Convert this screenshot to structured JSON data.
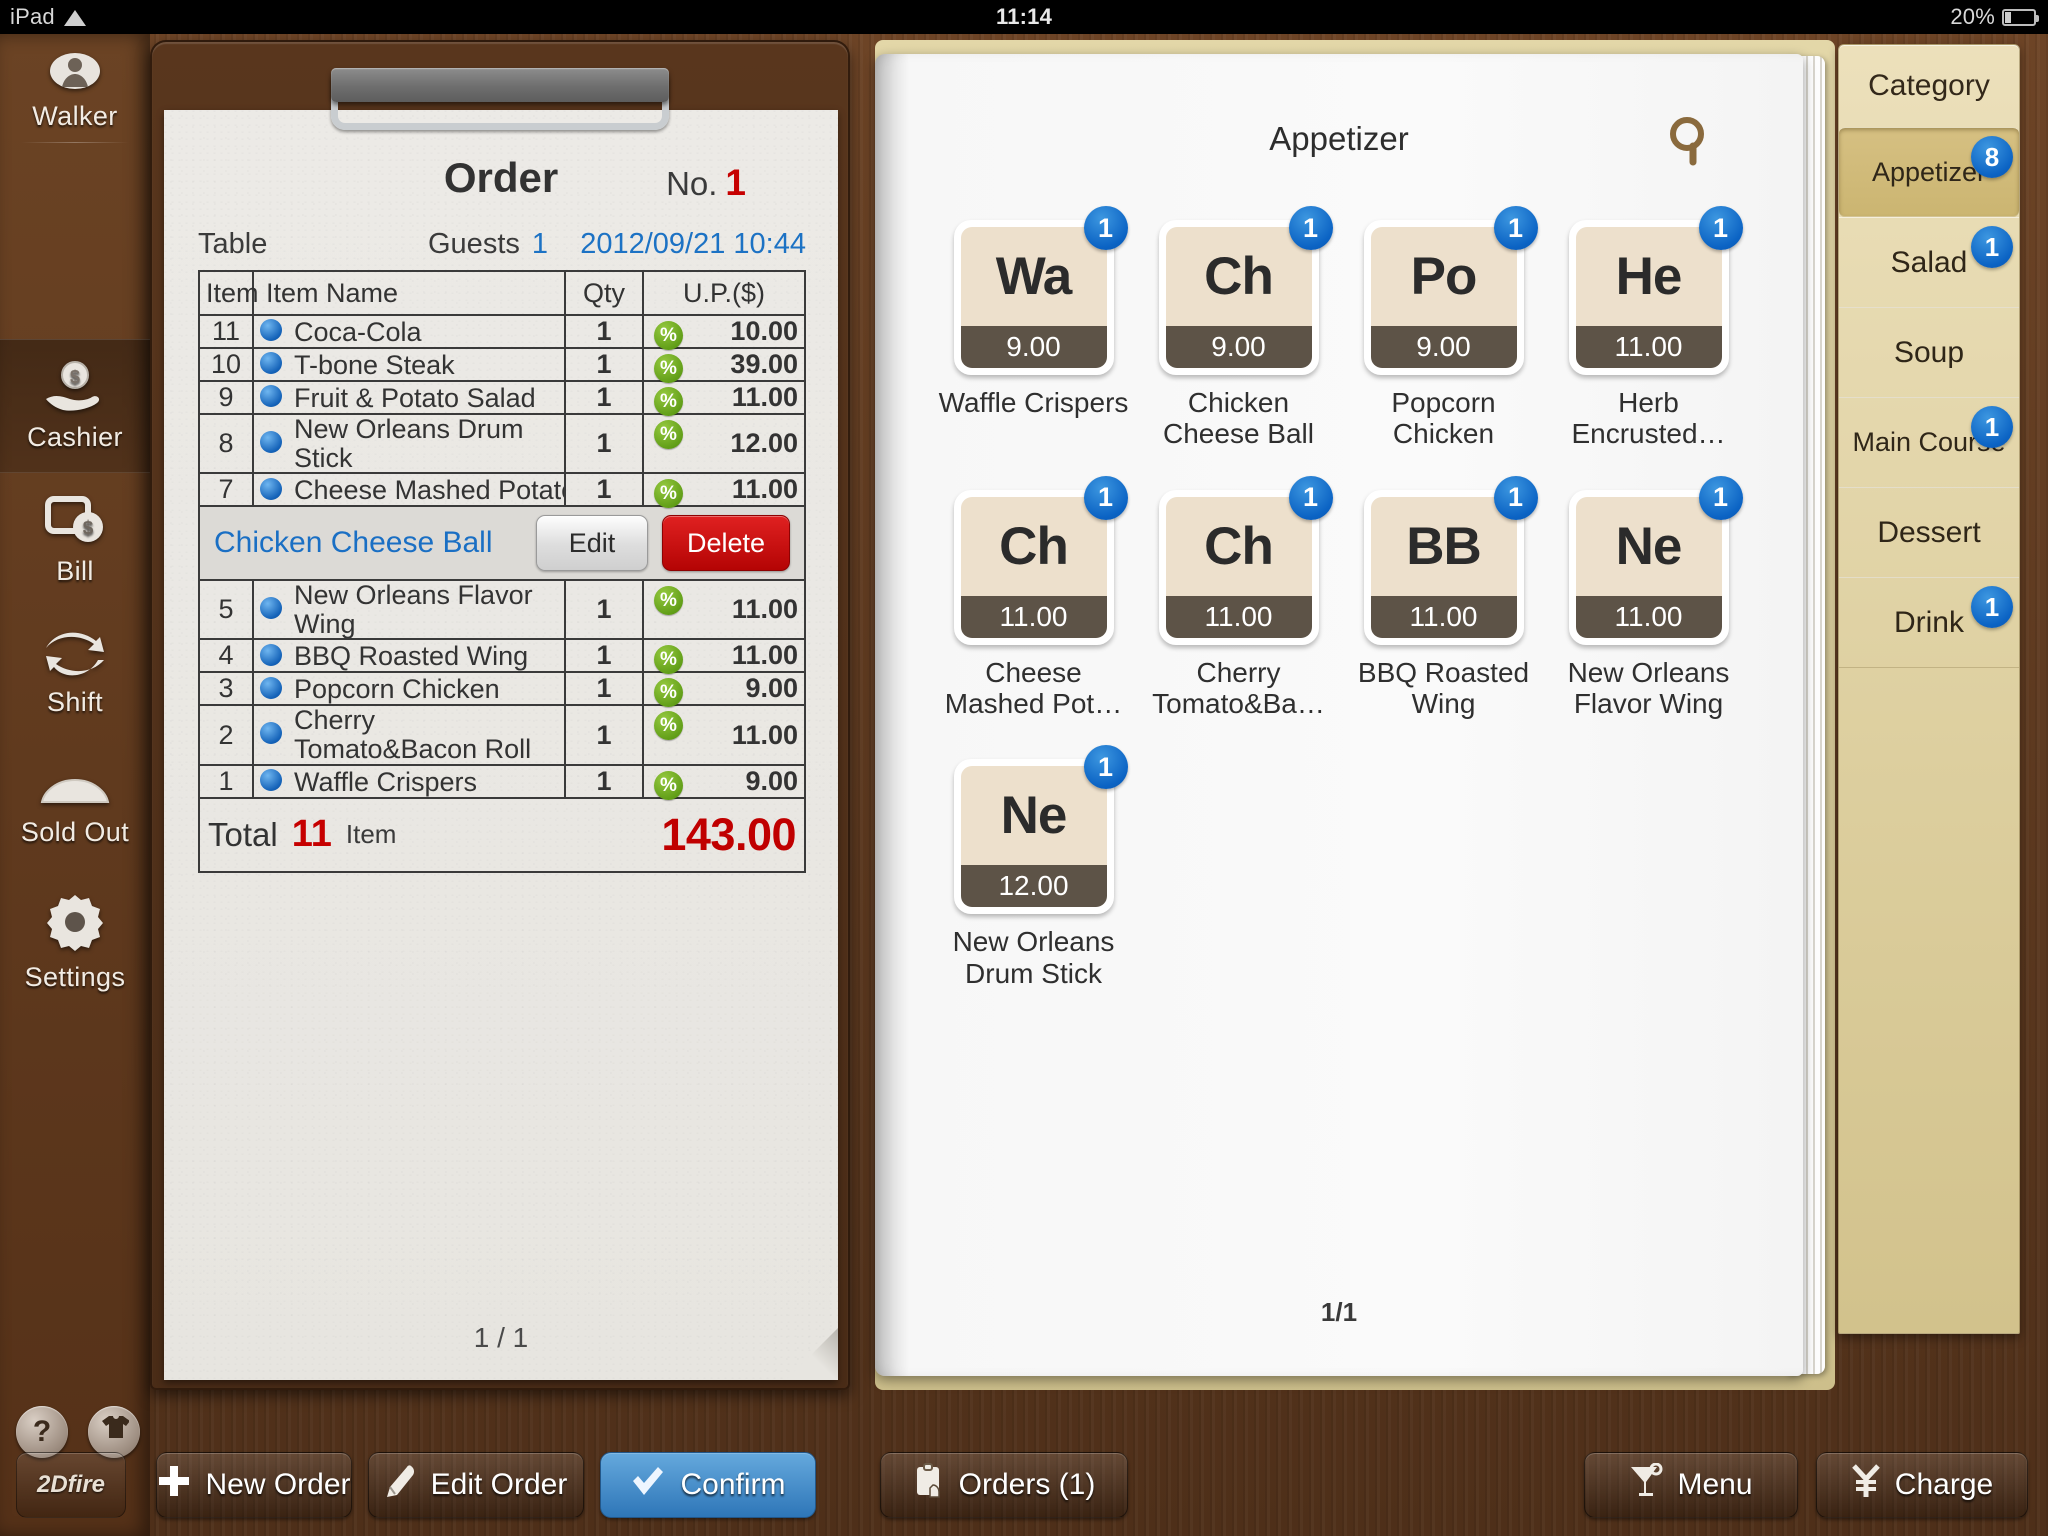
{
  "statusbar": {
    "device": "iPad",
    "wifi_icon": "wifi-icon",
    "time": "11:14",
    "battery": "20%"
  },
  "sidebar": {
    "user": {
      "label": "Walker",
      "icon": "user-avatar-icon"
    },
    "items": [
      {
        "label": "Cashier",
        "icon": "cash-hand-icon",
        "selected": true
      },
      {
        "label": "Bill",
        "icon": "bill-icon",
        "selected": false
      },
      {
        "label": "Shift",
        "icon": "shift-arrows-icon",
        "selected": false
      },
      {
        "label": "Sold Out",
        "icon": "sold-out-icon",
        "selected": false
      },
      {
        "label": "Settings",
        "icon": "gear-icon",
        "selected": false
      }
    ],
    "help": {
      "question_label": "?",
      "theme_icon": "tshirt-icon"
    }
  },
  "order": {
    "title": "Order",
    "no_label": "No.",
    "no_value": "1",
    "table_label": "Table",
    "guests_label": "Guests",
    "guests_value": "1",
    "datetime": "2012/09/21 10:44",
    "columns": [
      "Item",
      "Item Name",
      "Qty",
      "U.P.($)"
    ],
    "rows": [
      {
        "idx": "11",
        "name": "Coca-Cola",
        "qty": "1",
        "price": "10.00",
        "pct": "%",
        "nowrap": true
      },
      {
        "idx": "10",
        "name": "T-bone Steak",
        "qty": "1",
        "price": "39.00",
        "pct": "%",
        "nowrap": true
      },
      {
        "idx": "9",
        "name": "Fruit & Potato Salad",
        "qty": "1",
        "price": "11.00",
        "pct": "%",
        "nowrap": true
      },
      {
        "idx": "8",
        "name": "New Orleans Drum Stick",
        "qty": "1",
        "price": "12.00",
        "pct": "%",
        "nowrap": false
      },
      {
        "idx": "7",
        "name": "Cheese Mashed Potato",
        "qty": "1",
        "price": "11.00",
        "pct": "%",
        "nowrap": true
      },
      {
        "idx": "5",
        "name": "New Orleans Flavor Wing",
        "qty": "1",
        "price": "11.00",
        "pct": "%",
        "nowrap": false
      },
      {
        "idx": "4",
        "name": "BBQ Roasted Wing",
        "qty": "1",
        "price": "11.00",
        "pct": "%",
        "nowrap": true
      },
      {
        "idx": "3",
        "name": "Popcorn Chicken",
        "qty": "1",
        "price": "9.00",
        "pct": "%",
        "nowrap": true
      },
      {
        "idx": "2",
        "name": "Cherry Tomato&Bacon Roll",
        "qty": "1",
        "price": "11.00",
        "pct": "%",
        "nowrap": false
      },
      {
        "idx": "1",
        "name": "Waffle Crispers",
        "qty": "1",
        "price": "9.00",
        "pct": "%",
        "nowrap": true
      }
    ],
    "swipe_row": {
      "name": "Chicken Cheese Ball",
      "edit_label": "Edit",
      "delete_label": "Delete"
    },
    "total": {
      "label": "Total",
      "count": "11",
      "unit": "Item",
      "amount": "143.00"
    },
    "page": "1 / 1"
  },
  "menu": {
    "title": "Appetizer",
    "search_icon": "search-icon",
    "page": "1/1",
    "tiles": [
      {
        "abbr": "Wa",
        "price": "9.00",
        "badge": "1",
        "label": "Waffle Crispers"
      },
      {
        "abbr": "Ch",
        "price": "9.00",
        "badge": "1",
        "label": "Chicken Cheese Ball"
      },
      {
        "abbr": "Po",
        "price": "9.00",
        "badge": "1",
        "label": "Popcorn Chicken"
      },
      {
        "abbr": "He",
        "price": "11.00",
        "badge": "1",
        "label": "Herb Encrusted…"
      },
      {
        "abbr": "Ch",
        "price": "11.00",
        "badge": "1",
        "label": "Cheese Mashed Pot…"
      },
      {
        "abbr": "Ch",
        "price": "11.00",
        "badge": "1",
        "label": "Cherry Tomato&Ba…"
      },
      {
        "abbr": "BB",
        "price": "11.00",
        "badge": "1",
        "label": "BBQ Roasted Wing"
      },
      {
        "abbr": "Ne",
        "price": "11.00",
        "badge": "1",
        "label": "New Orleans Flavor Wing"
      },
      {
        "abbr": "Ne",
        "price": "12.00",
        "badge": "1",
        "label": "New Orleans Drum Stick"
      }
    ]
  },
  "categories": {
    "title": "Category",
    "items": [
      {
        "label": "Appetizer",
        "badge": "8",
        "selected": true
      },
      {
        "label": "Salad",
        "badge": "1",
        "selected": false
      },
      {
        "label": "Soup",
        "badge": "",
        "selected": false
      },
      {
        "label": "Main Course",
        "badge": "1",
        "selected": false
      },
      {
        "label": "Dessert",
        "badge": "",
        "selected": false
      },
      {
        "label": "Drink",
        "badge": "1",
        "selected": false
      }
    ]
  },
  "toolbar": {
    "logo": "2Dfire",
    "new_order": "New Order",
    "edit_order": "Edit Order",
    "confirm": "Confirm",
    "orders": "Orders (1)",
    "menu": "Menu",
    "charge": "Charge"
  },
  "colors": {
    "accent_blue": "#1a6fc4",
    "danger_red": "#c00000",
    "badge_blue": "#0b63c4",
    "tile_cream": "#ede0cc",
    "tile_band": "#5d5347"
  }
}
